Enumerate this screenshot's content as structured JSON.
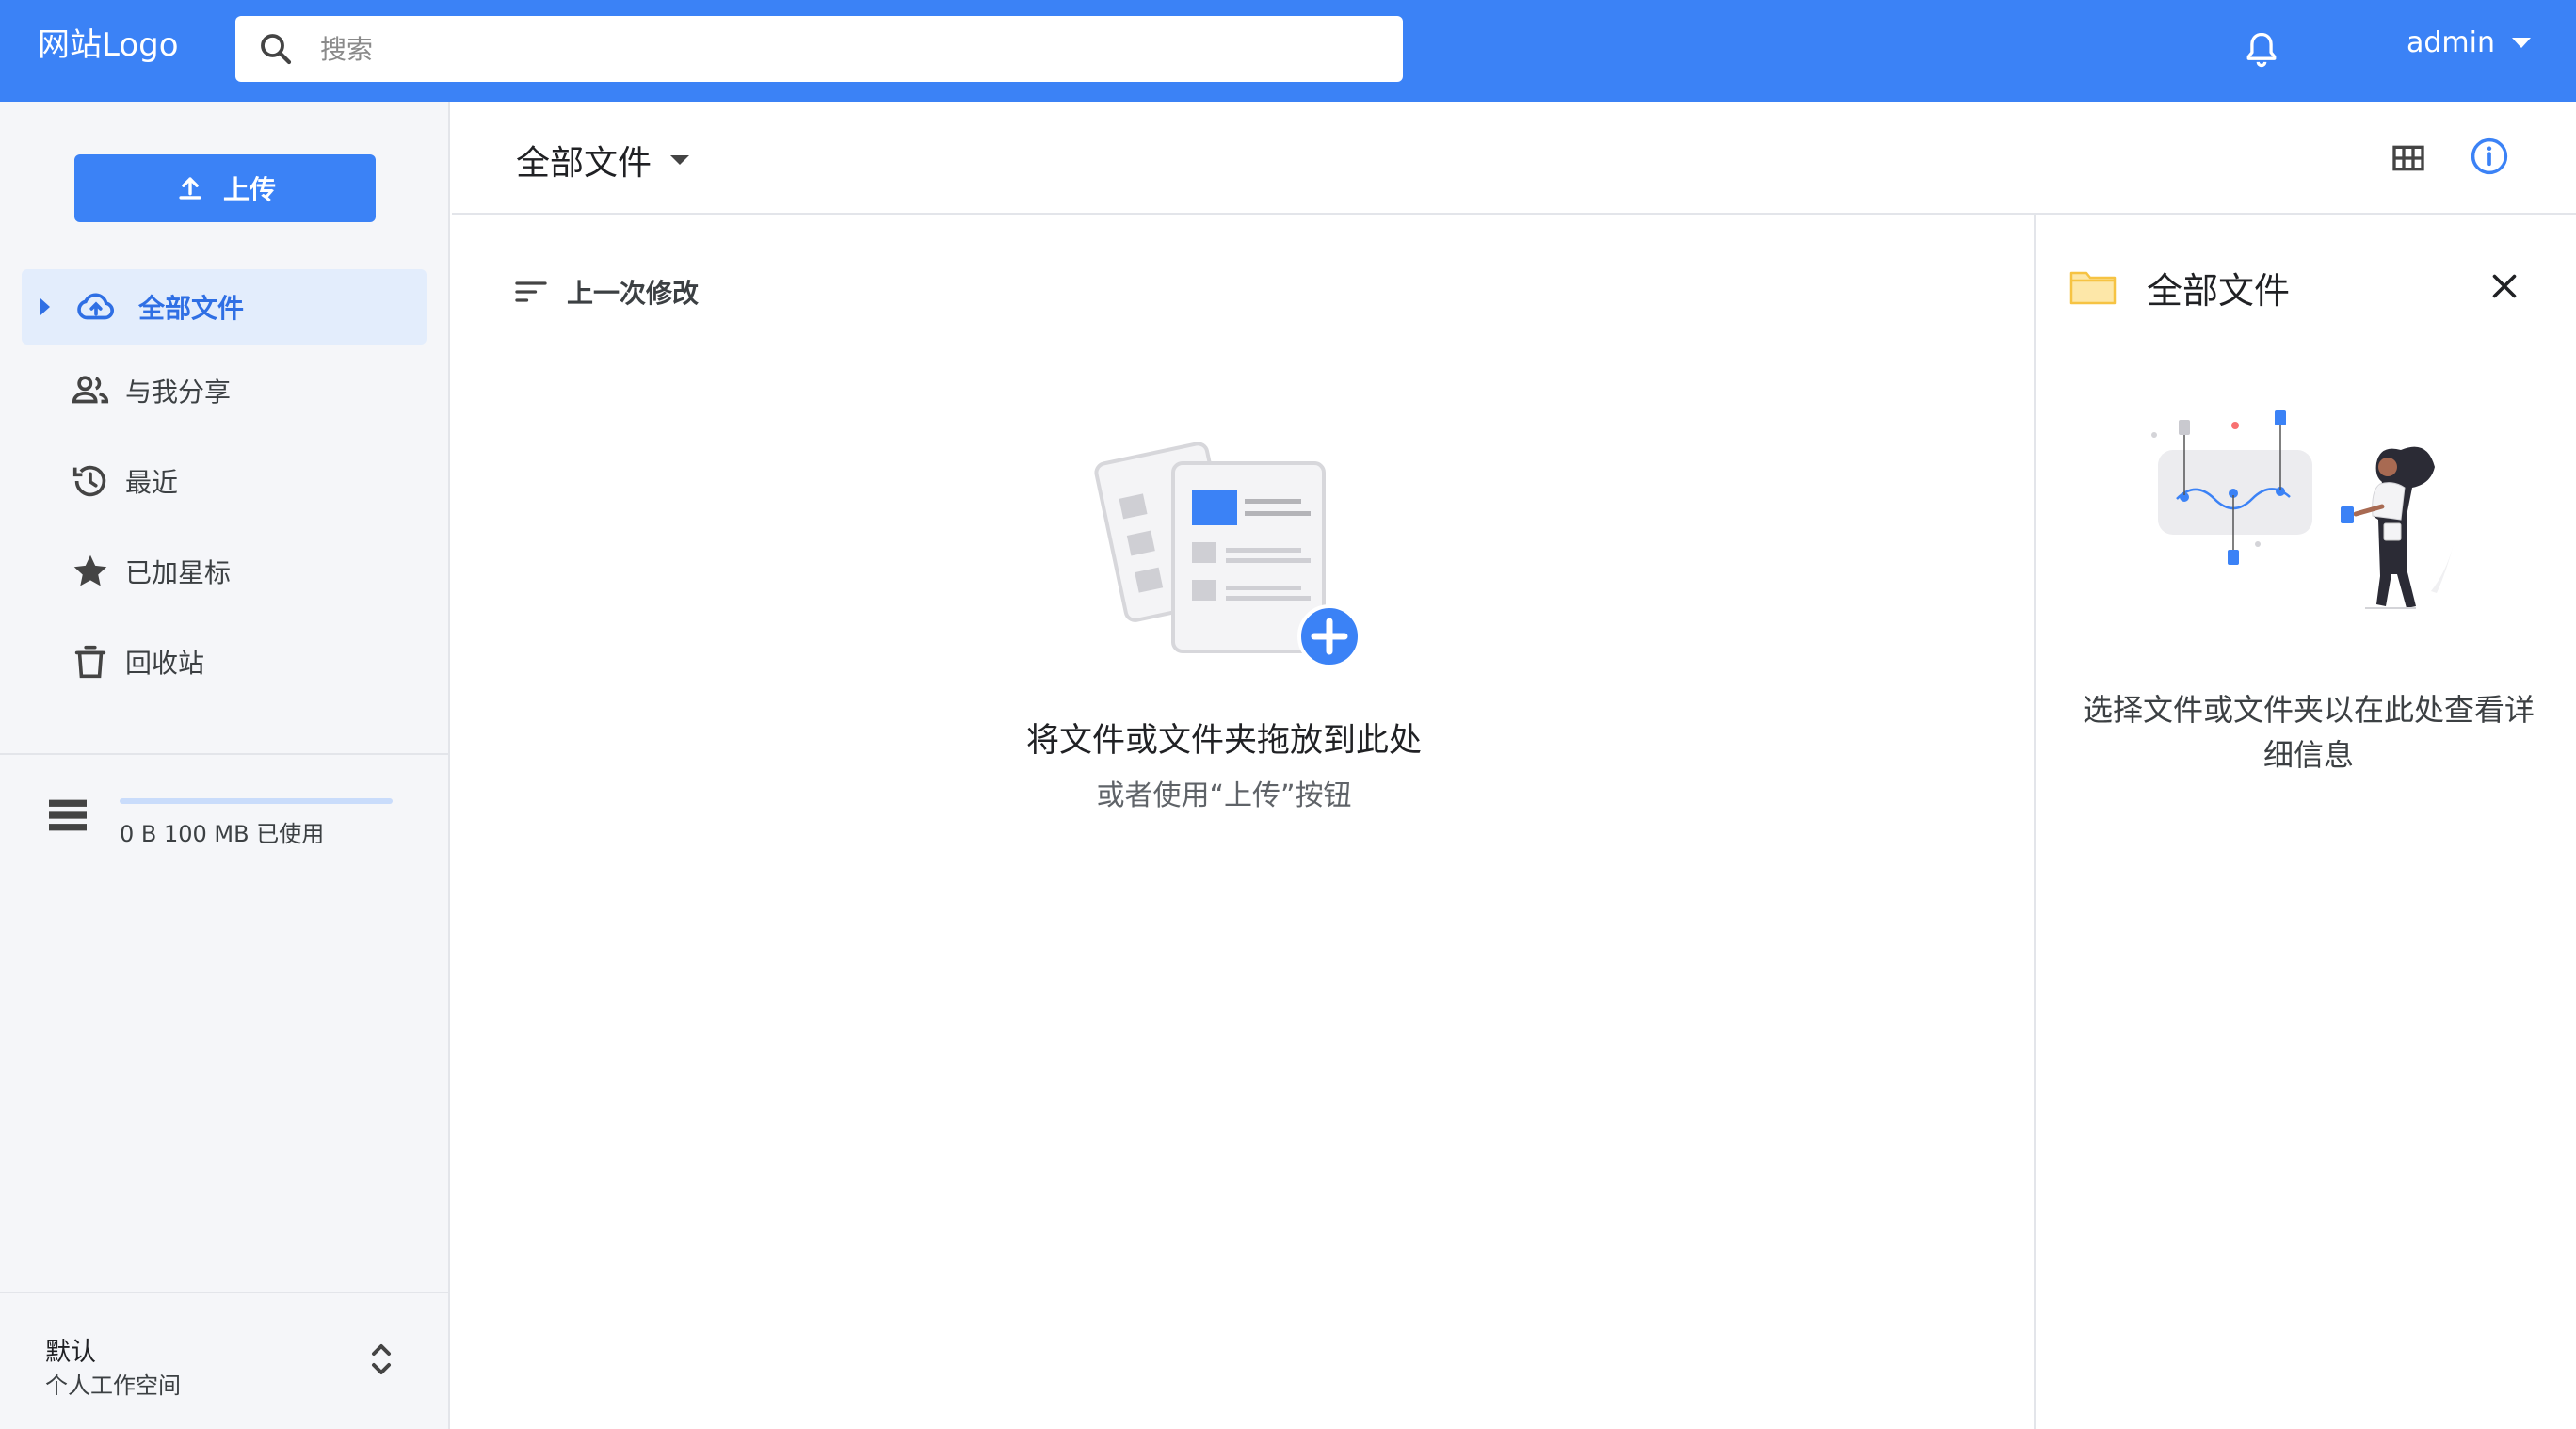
{
  "header": {
    "logo": "网站Logo",
    "search_placeholder": "搜索",
    "user": "admin"
  },
  "sidebar": {
    "upload_label": "上传",
    "items": [
      {
        "label": "全部文件",
        "icon": "cloud-upload-icon",
        "active": true
      },
      {
        "label": "与我分享",
        "icon": "people-icon"
      },
      {
        "label": "最近",
        "icon": "history-icon"
      },
      {
        "label": "已加星标",
        "icon": "star-icon"
      },
      {
        "label": "回收站",
        "icon": "trash-icon"
      }
    ],
    "storage": {
      "text": "0 B 100 MB 已使用",
      "used_fraction": 0.0
    },
    "workspace": {
      "name": "默认",
      "subtitle": "个人工作空间"
    }
  },
  "main": {
    "breadcrumb": "全部文件",
    "sort_label": "上一次修改",
    "empty": {
      "title": "将文件或文件夹拖放到此处",
      "subtitle": "或者使用“上传”按钮"
    }
  },
  "panel": {
    "title": "全部文件",
    "hint": "选择文件或文件夹以在此处查看详细信息"
  },
  "colors": {
    "accent": "#3b82f6",
    "sidebar_bg": "#f5f6f9",
    "active_bg": "#e3edfc",
    "folder": "#f6c343"
  }
}
